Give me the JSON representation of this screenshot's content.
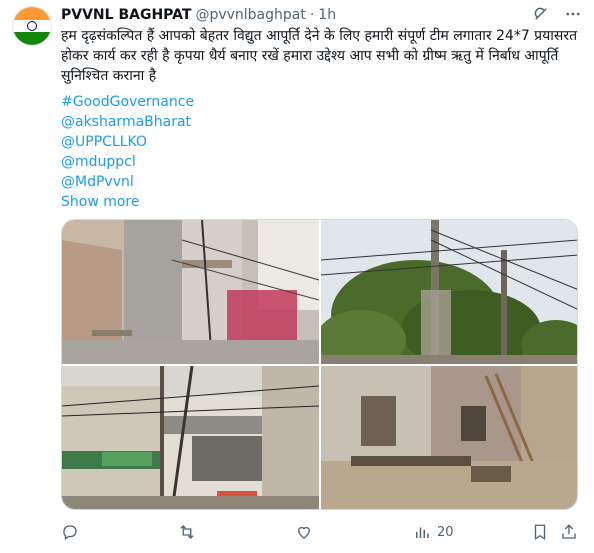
{
  "tweet": {
    "author_name": "PVVNL BAGHPAT",
    "handle": "@pvvnlbaghpat",
    "separator": "·",
    "time": "1h",
    "text": "हम दृढ़संकल्पित हैं आपको बेहतर विद्युत आपूर्ति देने के लिए हमारी संपूर्ण टीम लगातार 24*7 प्रयासरत होकर कार्य कर रही है कृपया धैर्य बनाए रखें हमारा उद्देश्य आप सभी को ग्रीष्म ऋतु में निर्बाध आपूर्ति सुनिश्चित कराना है",
    "hashtags": [
      "#GoodGovernance",
      "@aksharmaBharat",
      "@UPPCLLKO",
      "@mduppcl",
      "@MdPvvnl"
    ],
    "show_more": "Show more",
    "views": "20"
  },
  "colors": {
    "link": "#1d9bf0",
    "muted": "#536471",
    "text": "#0f1419"
  },
  "icons": {
    "avatar": "indian-flag",
    "grok": "grok-icon",
    "more": "more-icon",
    "reply": "reply-icon",
    "retweet": "retweet-icon",
    "like": "heart-icon",
    "views": "views-icon",
    "bookmark": "bookmark-icon",
    "share": "share-icon"
  }
}
